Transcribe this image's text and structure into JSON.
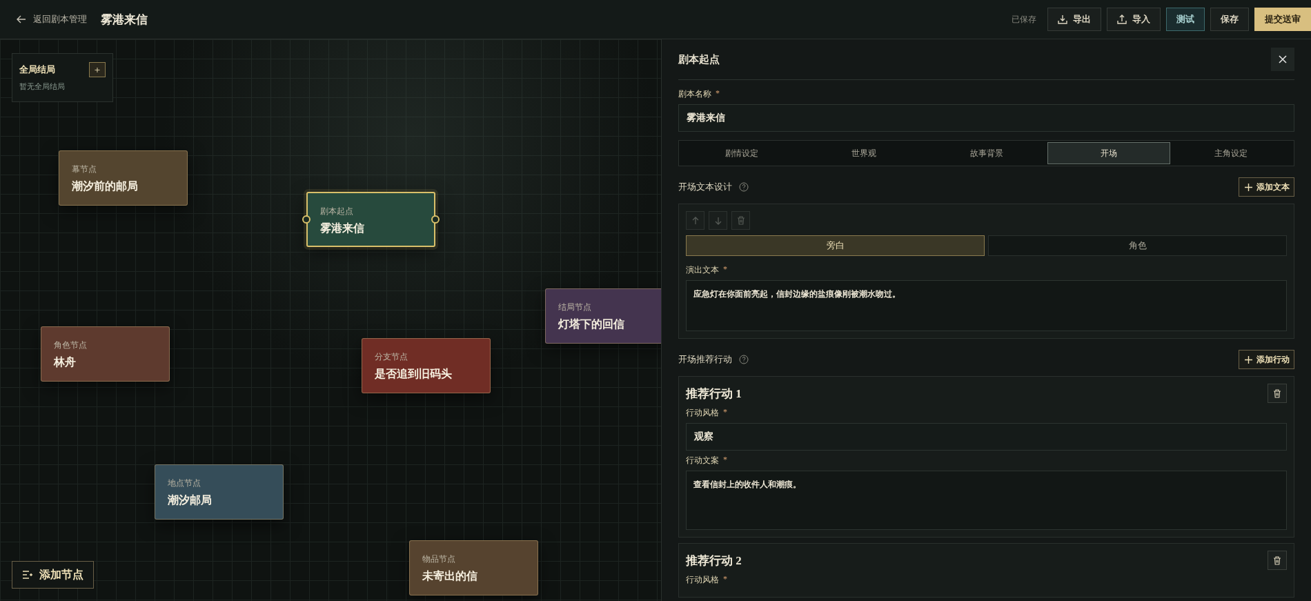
{
  "header": {
    "back_link": "返回剧本管理",
    "title": "雾港来信",
    "save_status": "已保存",
    "buttons": [
      {
        "label": "导出",
        "kind": "export"
      },
      {
        "label": "导入",
        "kind": "import"
      },
      {
        "label": "测试",
        "kind": "test"
      },
      {
        "label": "保存",
        "kind": "plain"
      },
      {
        "label": "提交送审",
        "kind": "primary"
      }
    ]
  },
  "global_endings": {
    "title": "全局结局",
    "add_button": "+",
    "empty_text": "暂无全局结局"
  },
  "nodes": [
    {
      "type_label": "幕节点",
      "title": "潮汐前的邮局",
      "color": "#54452f",
      "selected": false
    },
    {
      "type_label": "剧本起点",
      "title": "雾港来信",
      "color": "#274a3d",
      "selected": true
    },
    {
      "type_label": "结局节点",
      "title": "灯塔下的回信",
      "color": "#44344f",
      "selected": false
    },
    {
      "type_label": "角色节点",
      "title": "林舟",
      "color": "#5e3a2e",
      "selected": false
    },
    {
      "type_label": "分支节点",
      "title": "是否追到旧码头",
      "color": "#702d25",
      "selected": false
    },
    {
      "type_label": "地点节点",
      "title": "潮汐邮局",
      "color": "#354d59",
      "selected": false
    },
    {
      "type_label": "物品节点",
      "title": "未寄出的信",
      "color": "#56432f",
      "selected": false
    }
  ],
  "add_node_button": "添加节点",
  "panel": {
    "title": "剧本起点",
    "name_field": {
      "label": "剧本名称",
      "required_mark": "*",
      "value": "雾港来信"
    },
    "tabs": [
      {
        "label": "剧情设定",
        "selected": false
      },
      {
        "label": "世界观",
        "selected": false
      },
      {
        "label": "故事背景",
        "selected": false
      },
      {
        "label": "开场",
        "selected": true
      },
      {
        "label": "主角设定",
        "selected": false
      }
    ],
    "opening_text": {
      "title": "开场文本设计",
      "add_button": "添加文本",
      "tools": [
        {
          "kind": "up",
          "disabled": true
        },
        {
          "kind": "down",
          "disabled": true
        },
        {
          "kind": "delete",
          "disabled": true
        }
      ],
      "speaker_options": [
        {
          "label": "旁白",
          "selected": true
        },
        {
          "label": "角色",
          "selected": false
        }
      ],
      "text_field": {
        "label": "演出文本",
        "required_mark": "*",
        "value": "应急灯在你面前亮起，信封边缘的盐痕像刚被潮水吻过。"
      }
    },
    "actions": {
      "title": "开场推荐行动",
      "add_button": "添加行动",
      "items": [
        {
          "title": "推荐行动 1",
          "style_field": {
            "label": "行动风格",
            "required_mark": "*",
            "value": "观察"
          },
          "copy_field": {
            "label": "行动文案",
            "required_mark": "*",
            "value": "查看信封上的收件人和潮痕。"
          }
        },
        {
          "title": "推荐行动 2",
          "style_field": {
            "label": "行动风格",
            "required_mark": "*"
          }
        }
      ]
    }
  }
}
